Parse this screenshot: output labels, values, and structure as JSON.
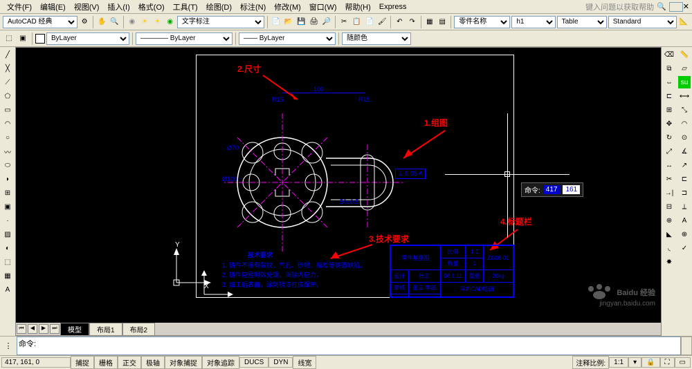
{
  "menu": {
    "items": [
      "文件(F)",
      "编辑(E)",
      "视图(V)",
      "插入(I)",
      "格式(O)",
      "工具(T)",
      "绘图(D)",
      "标注(N)",
      "修改(M)",
      "窗口(W)",
      "帮助(H)",
      "Express"
    ],
    "help_hint": "键入问题以获取帮助"
  },
  "toolbar2": {
    "workspace": "AutoCAD 经典",
    "text_style": "文字标注"
  },
  "toolbar3": {
    "partname_label": "零件名称",
    "h1": "h1",
    "table": "Table",
    "standard": "Standard"
  },
  "toolbar4": {
    "bylayer": "ByLayer",
    "color": "随颜色"
  },
  "tabs": {
    "model": "模型",
    "layout1": "布局1",
    "layout2": "布局2"
  },
  "status": {
    "coords": "417, 161, 0",
    "buttons": [
      "捕捉",
      "栅格",
      "正交",
      "极轴",
      "对象捕捉",
      "对象追踪",
      "DUCS",
      "DYN",
      "线宽"
    ],
    "anno_label": "注释比例:",
    "anno_scale": "1:1"
  },
  "tooltip": {
    "label": "命令:",
    "v1": "417",
    "v2": "161"
  },
  "annotations": {
    "a1": "1.组图",
    "a2": "2.尺寸",
    "a3": "3.技术要求",
    "a4": "4.标题栏"
  },
  "dims": {
    "d100": "100",
    "r15a": "R15",
    "r15b": "R15",
    "phi70": "Ø70",
    "phi100": "Ø100",
    "tol": "⊥ 0.05 A",
    "b50": "50±0.5"
  },
  "tech": {
    "title": "技术要求",
    "l1": "1. 铸件不得有裂纹、气孔、砂眼、缩松等铸造缺陷。",
    "l2": "2. 铸件应经时效处理，消除内应力。",
    "l3": "3. 加工后表面，涂防锈漆打底保护。"
  },
  "title_block": {
    "name": "零件基座图",
    "scale_l": "比例",
    "scale_v": "1:1",
    "mat_l": "材料",
    "mat_v": "ZG06-01",
    "qty_l": "数量",
    "qty_v": "1",
    "date_l": "日期",
    "date_v": "06.1.11",
    "wt_l": "重量",
    "wt_v": "20kg",
    "chk_l": "审核",
    "chk_v": "张三  李四",
    "des_l": "设计",
    "des_v": "张三",
    "company": "深圳CAD培训"
  },
  "ucs": {
    "x": "X",
    "y": "Y"
  },
  "watermark": {
    "brand": "Baidu 经验",
    "url": "jingyan.baidu.com"
  },
  "cmd": {
    "prompt": "命令:"
  }
}
